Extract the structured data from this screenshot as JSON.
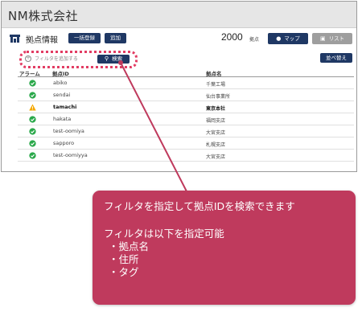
{
  "app": {
    "company": "NM株式会社"
  },
  "toolbar": {
    "title": "拠点情報",
    "bulk_register": "一括登録",
    "add": "追加",
    "count": "2000",
    "count_unit": "拠点",
    "map_label": "マップ",
    "list_label": "リスト"
  },
  "filter": {
    "placeholder": "フィルタを追加する",
    "search_label": "検索",
    "sort_label": "並べ替え"
  },
  "table": {
    "headers": {
      "alarm": "アラーム",
      "id": "拠点ID",
      "name": "拠点名"
    },
    "rows": [
      {
        "status": "ok",
        "id": "abiko",
        "name": "千葉工場"
      },
      {
        "status": "ok",
        "id": "sendai",
        "name": "仙台事業所"
      },
      {
        "status": "warning",
        "id": "tamachi",
        "name": "東京本社"
      },
      {
        "status": "ok",
        "id": "hakata",
        "name": "福岡支店"
      },
      {
        "status": "ok",
        "id": "test-oomiya",
        "name": "大宮支店"
      },
      {
        "status": "ok",
        "id": "sapporo",
        "name": "札幌支店"
      },
      {
        "status": "ok",
        "id": "test-oomiyya",
        "name": "大宮支店"
      }
    ]
  },
  "callout": {
    "line1": "フィルタを指定して拠点IDを検索できます",
    "line2": "フィルタは以下を指定可能",
    "items": [
      "・拠点名",
      "・住所",
      "・タグ"
    ]
  },
  "colors": {
    "navy": "#1f3864",
    "ok": "#2aa84a",
    "warning": "#f5a800",
    "accent": "#bf3a5d",
    "highlight": "#e23c63"
  }
}
